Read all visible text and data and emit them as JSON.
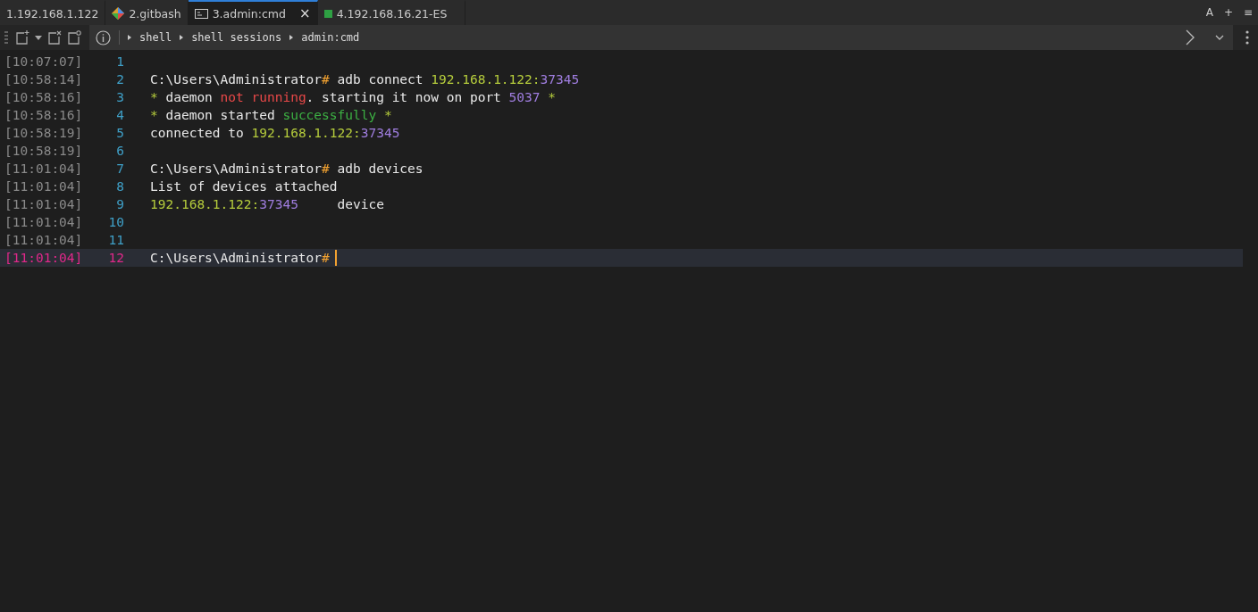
{
  "tabs": [
    {
      "label": "1.192.168.1.122",
      "kind": "plain",
      "selected": false
    },
    {
      "label": "2.gitbash",
      "kind": "git",
      "selected": false
    },
    {
      "label": "3.admin:cmd",
      "kind": "cmd",
      "selected": true,
      "close": "×"
    },
    {
      "label": "4.192.168.16.21-ES",
      "kind": "remote",
      "selected": false
    }
  ],
  "window_controls": [
    "A",
    "+",
    "≡"
  ],
  "breadcrumbs": [
    "shell",
    "shell sessions",
    "admin:cmd"
  ],
  "lines": [
    {
      "time": "[10:07:07]",
      "number": "1",
      "selected": false
    },
    {
      "time": "[10:58:14]",
      "number": "2",
      "selected": false,
      "segments": [
        {
          "kind": "text",
          "text": "C:\\Users\\Administrator"
        },
        {
          "kind": "prompt",
          "text": "#"
        },
        {
          "kind": "text",
          "text": " adb connect "
        },
        {
          "kind": "ip",
          "text": "192.168.1.122:"
        },
        {
          "kind": "number",
          "text": "37345"
        }
      ]
    },
    {
      "time": "[10:58:16]",
      "number": "3",
      "selected": false,
      "segments": [
        {
          "kind": "star",
          "text": "*"
        },
        {
          "kind": "text",
          "text": " daemon "
        },
        {
          "kind": "error",
          "text": "not running"
        },
        {
          "kind": "text",
          "text": ". starting it now on port "
        },
        {
          "kind": "number",
          "text": "5037"
        },
        {
          "kind": "star",
          "text": " *"
        }
      ]
    },
    {
      "time": "[10:58:16]",
      "number": "4",
      "selected": false,
      "segments": [
        {
          "kind": "star",
          "text": "*"
        },
        {
          "kind": "text",
          "text": " daemon started "
        },
        {
          "kind": "success",
          "text": "successfully"
        },
        {
          "kind": "star",
          "text": " *"
        }
      ]
    },
    {
      "time": "[10:58:19]",
      "number": "5",
      "selected": false,
      "segments": [
        {
          "kind": "text",
          "text": "connected to "
        },
        {
          "kind": "ip",
          "text": "192.168.1.122:"
        },
        {
          "kind": "number",
          "text": "37345"
        }
      ]
    },
    {
      "time": "[10:58:19]",
      "number": "6",
      "selected": false
    },
    {
      "time": "[11:01:04]",
      "number": "7",
      "selected": false,
      "segments": [
        {
          "kind": "text",
          "text": "C:\\Users\\Administrator"
        },
        {
          "kind": "prompt",
          "text": "#"
        },
        {
          "kind": "text",
          "text": " adb devices"
        }
      ]
    },
    {
      "time": "[11:01:04]",
      "number": "8",
      "selected": false,
      "segments": [
        {
          "kind": "text",
          "text": "List of devices attached"
        }
      ]
    },
    {
      "time": "[11:01:04]",
      "number": "9",
      "selected": false,
      "segments": [
        {
          "kind": "ip",
          "text": "192.168.1.122:"
        },
        {
          "kind": "number",
          "text": "37345"
        },
        {
          "kind": "text",
          "text": "     device"
        }
      ]
    },
    {
      "time": "[11:01:04]",
      "number": "10",
      "selected": false
    },
    {
      "time": "[11:01:04]",
      "number": "11",
      "selected": false
    },
    {
      "time": "[11:01:04]",
      "number": "12",
      "selected": true,
      "segments": [
        {
          "kind": "text",
          "text": "C:\\Users\\Administrator"
        },
        {
          "kind": "prompt",
          "text": "#"
        }
      ]
    }
  ]
}
